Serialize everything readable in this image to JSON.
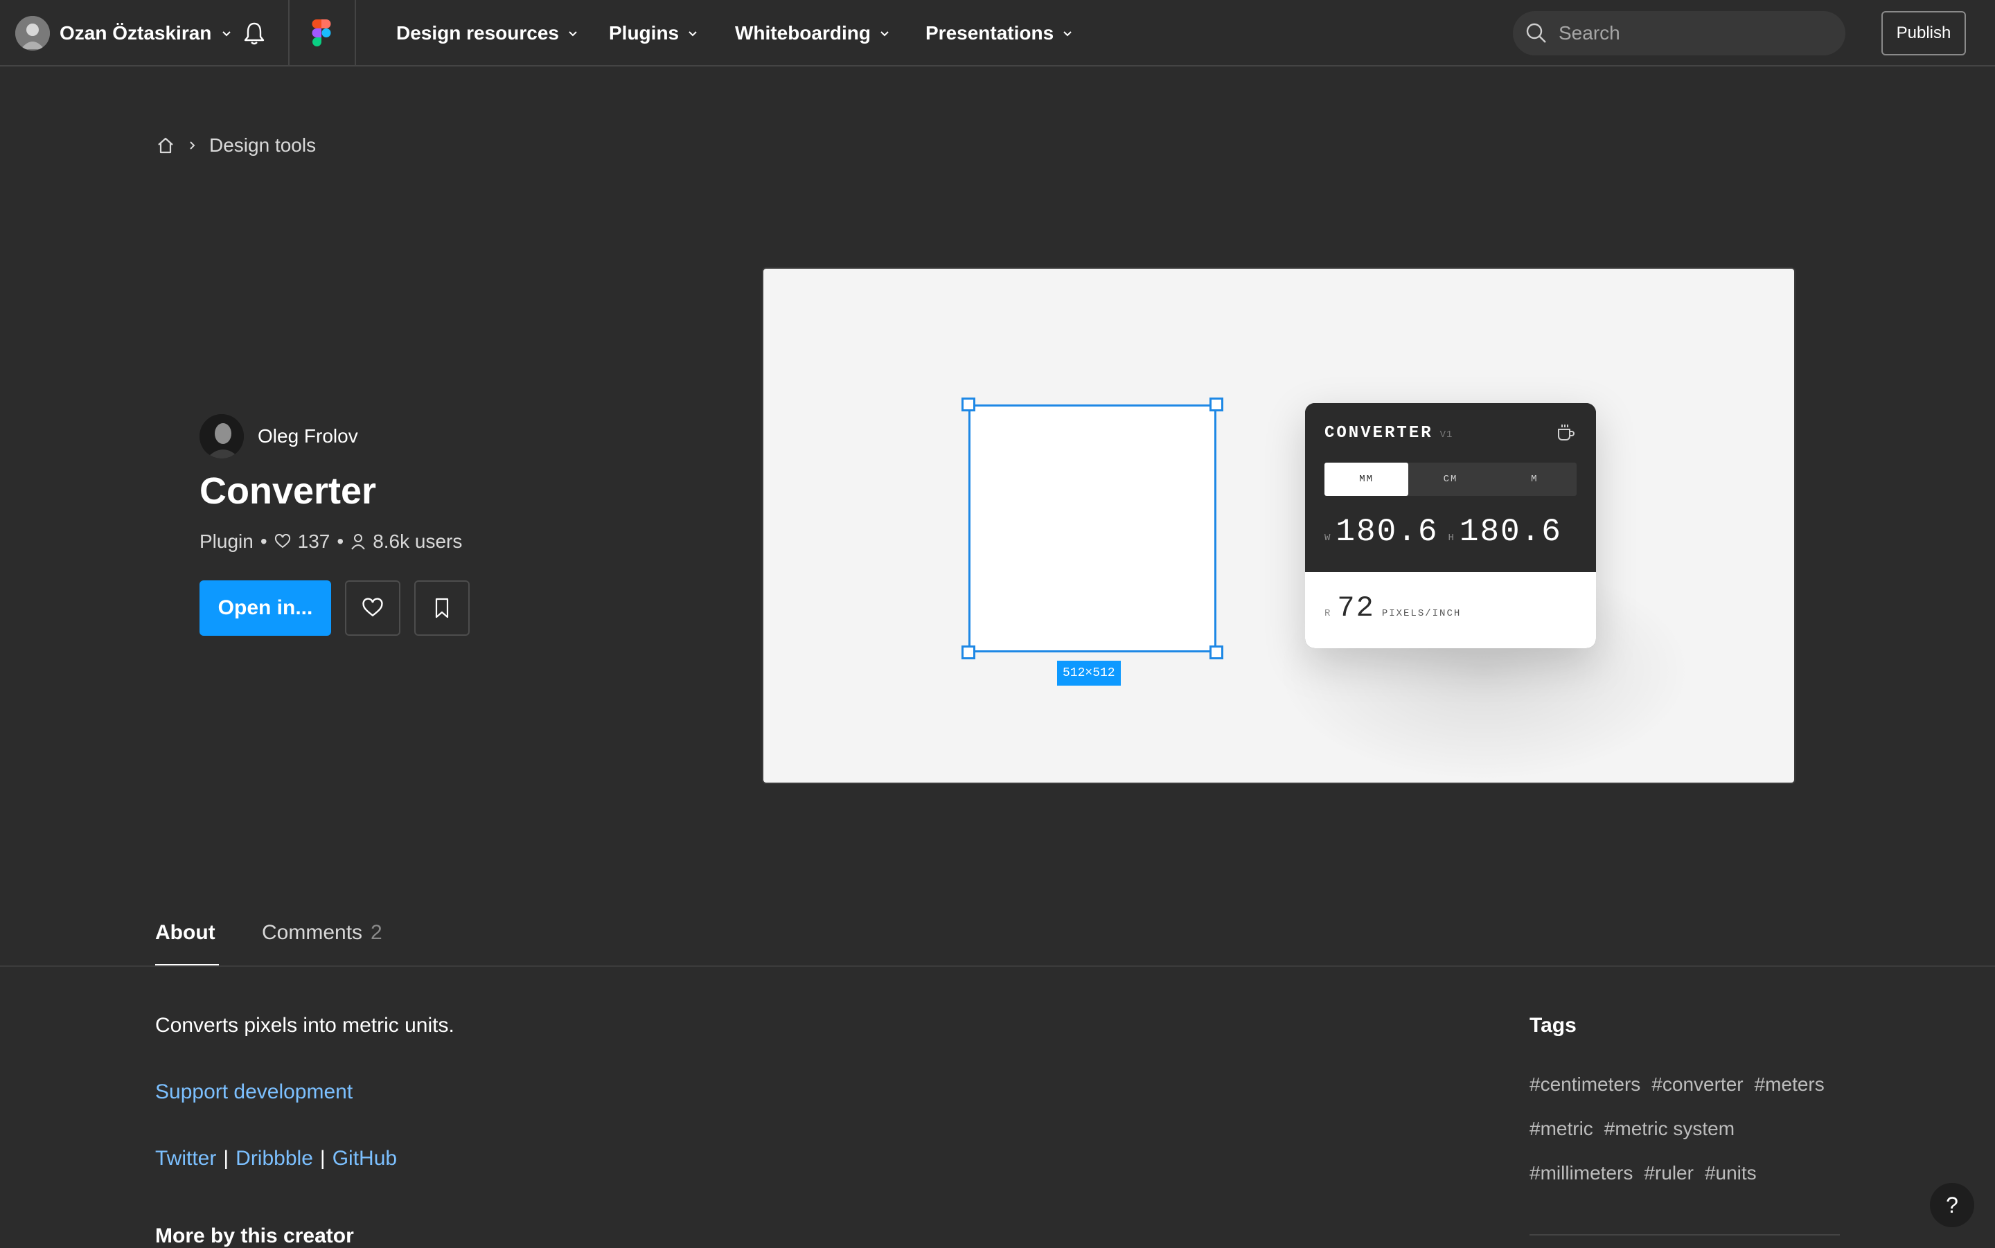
{
  "topbar": {
    "user_name": "Ozan Öztaskiran",
    "nav": [
      "Design resources",
      "Plugins",
      "Whiteboarding",
      "Presentations"
    ],
    "search_placeholder": "Search",
    "publish_label": "Publish"
  },
  "breadcrumb": {
    "current": "Design tools"
  },
  "plugin": {
    "creator": "Oleg Frolov",
    "title": "Converter",
    "type": "Plugin",
    "likes": "137",
    "users": "8.6k users",
    "open_label": "Open in..."
  },
  "preview": {
    "dimension_label": "512×512",
    "card": {
      "title": "CONVERTER",
      "version": "V1",
      "tabs": [
        "MM",
        "CM",
        "M"
      ],
      "active_tab": "MM",
      "w_label": "W",
      "width_value": "180.6",
      "h_label": "H",
      "height_value": "180.6",
      "r_label": "R",
      "resolution_value": "72",
      "resolution_unit": "PIXELS/INCH"
    }
  },
  "tabs": {
    "about": "About",
    "comments": "Comments",
    "comments_count": "2"
  },
  "about": {
    "description": "Converts pixels into metric units.",
    "support_link": "Support development",
    "socials": [
      "Twitter",
      "Dribbble",
      "GitHub"
    ],
    "separator": "|",
    "more_heading": "More by this creator"
  },
  "tags": {
    "title": "Tags",
    "rows": [
      [
        "#centimeters",
        "#converter",
        "#meters"
      ],
      [
        "#metric",
        "#metric system"
      ],
      [
        "#millimeters",
        "#ruler",
        "#units"
      ]
    ]
  },
  "help": {
    "label": "?"
  },
  "colors": {
    "background": "#2c2c2c",
    "accent": "#0d99ff",
    "link": "#7cc0ff",
    "selection": "#1e88e5"
  }
}
